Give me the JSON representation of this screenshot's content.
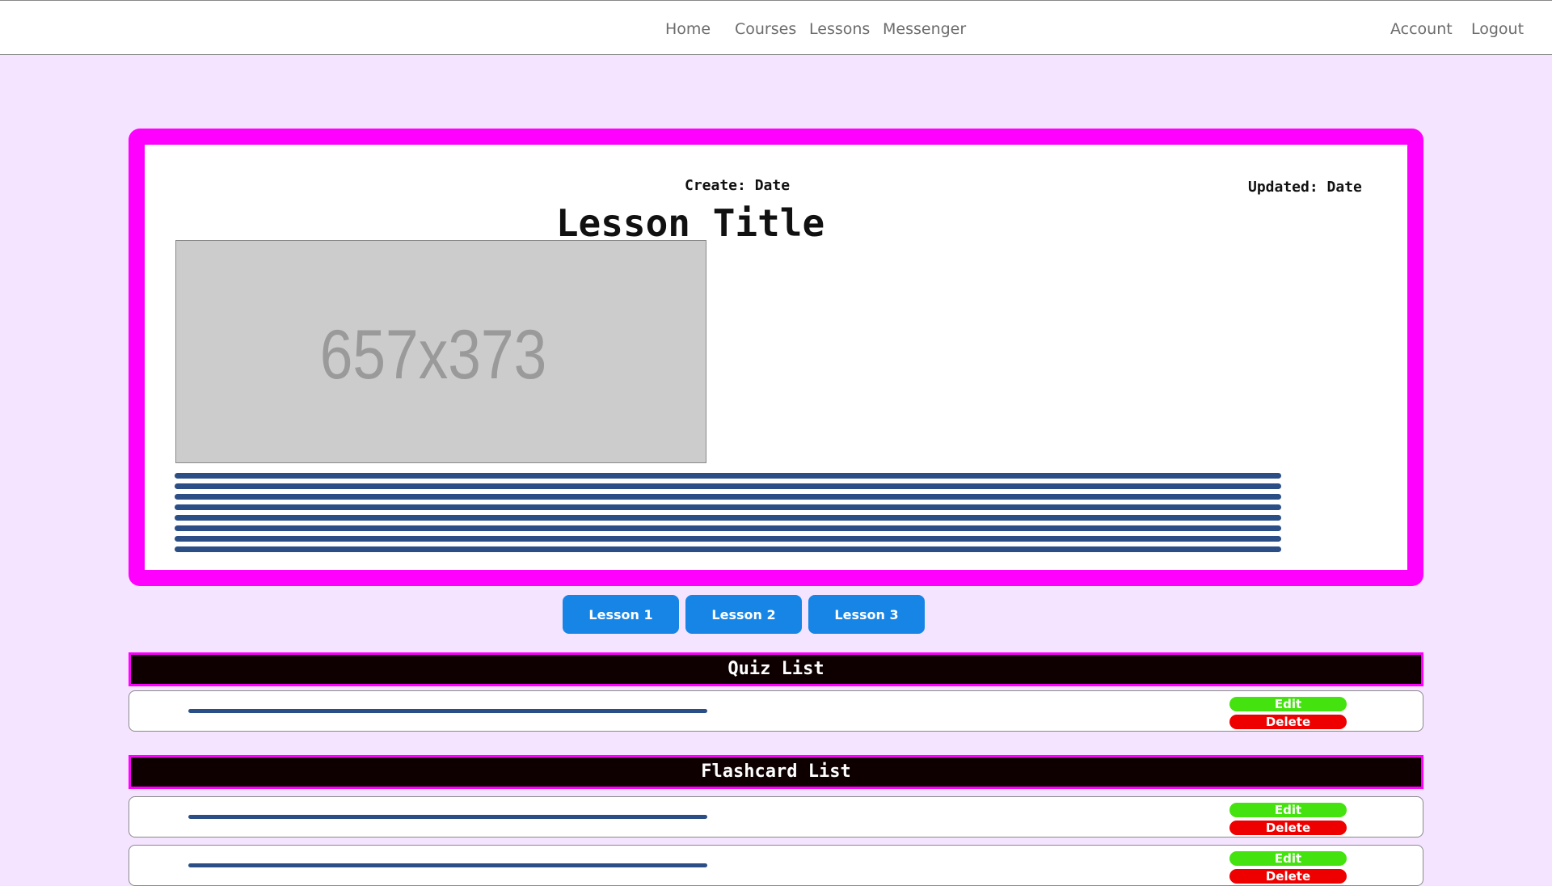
{
  "nav": {
    "home": "Home",
    "courses": "Courses",
    "lessons": "Lessons",
    "messenger": "Messenger",
    "account": "Account",
    "logout": "Logout"
  },
  "lesson": {
    "created": "Create: Date",
    "updated": "Updated: Date",
    "title": "Lesson Title",
    "image_placeholder": "657x373"
  },
  "lesson_buttons": [
    "Lesson 1",
    "Lesson 2",
    "Lesson 3"
  ],
  "quiz": {
    "header": "Quiz List",
    "edit_label": "Edit",
    "delete_label": "Delete"
  },
  "flashcard": {
    "header": "Flashcard List",
    "edit_label": "Edit",
    "delete_label": "Delete"
  },
  "colors": {
    "page_bg": "#f4e4ff",
    "accent_border": "#ff00ff",
    "lesson_button": "#1785e6",
    "edit": "#44e20e",
    "delete": "#ee0000",
    "text_line": "#2a4e85"
  }
}
